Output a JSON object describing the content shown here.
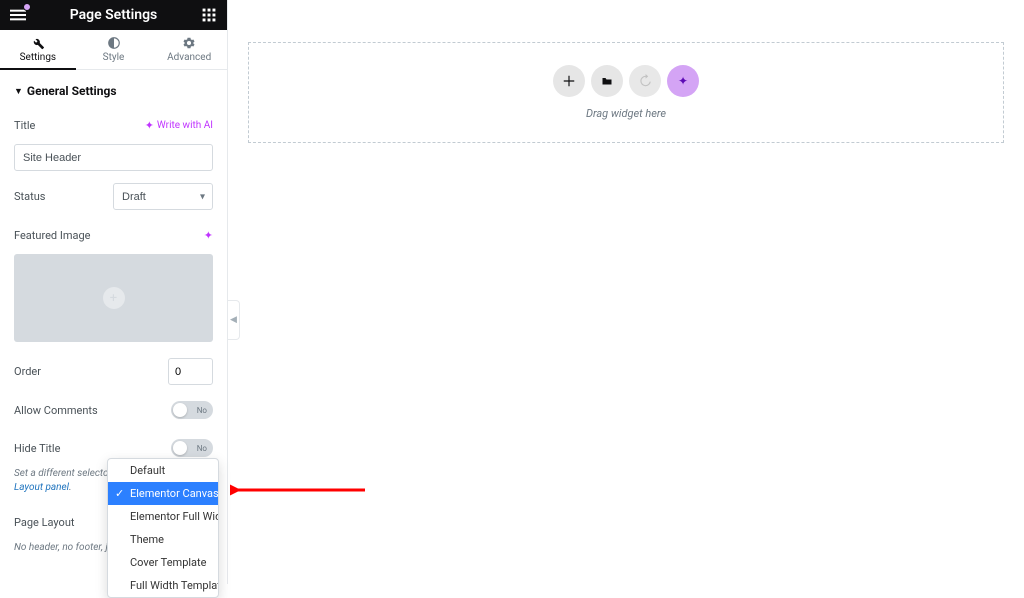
{
  "header": {
    "title": "Page Settings"
  },
  "tabs": [
    {
      "id": "settings",
      "label": "Settings",
      "active": true
    },
    {
      "id": "style",
      "label": "Style",
      "active": false
    },
    {
      "id": "advanced",
      "label": "Advanced",
      "active": false
    }
  ],
  "section": {
    "generalTitle": "General Settings"
  },
  "controls": {
    "title": {
      "label": "Title",
      "aiBtn": "Write with AI",
      "value": "Site Header"
    },
    "status": {
      "label": "Status",
      "value": "Draft"
    },
    "featured": {
      "label": "Featured Image"
    },
    "order": {
      "label": "Order",
      "value": "0"
    },
    "allowComments": {
      "label": "Allow Comments",
      "value": "No"
    },
    "hideTitle": {
      "label": "Hide Title",
      "value": "No"
    },
    "hideTitleHelp": {
      "prefix": "Set a different selector for the title in the ",
      "link": "Layout panel",
      "suffix": "."
    },
    "pageLayout": {
      "label": "Page Layout"
    },
    "pageLayoutHelp": "No header, no footer, ju"
  },
  "dropdown": {
    "items": [
      "Default",
      "Elementor Canvas",
      "Elementor Full Width",
      "Theme",
      "Cover Template",
      "Full Width Template"
    ],
    "selectedIndex": 1
  },
  "canvas": {
    "dragText": "Drag widget here"
  }
}
